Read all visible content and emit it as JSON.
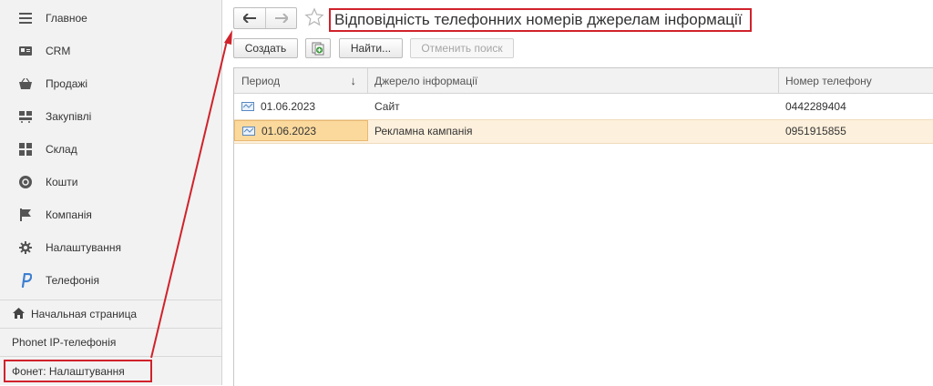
{
  "sidebar": {
    "items": [
      {
        "label": "Главное",
        "icon": "menu-icon"
      },
      {
        "label": "CRM",
        "icon": "crm-icon"
      },
      {
        "label": "Продажі",
        "icon": "basket-icon"
      },
      {
        "label": "Закупівлі",
        "icon": "purchases-icon"
      },
      {
        "label": "Склад",
        "icon": "warehouse-icon"
      },
      {
        "label": "Кошти",
        "icon": "money-icon"
      },
      {
        "label": "Компанія",
        "icon": "flag-icon"
      },
      {
        "label": "Налаштування",
        "icon": "gear-icon"
      },
      {
        "label": "Телефонія",
        "icon": "phonet-logo-icon"
      }
    ],
    "bottom": {
      "home": "Начальная страница",
      "phonet": "Phonet IP-телефонія",
      "settings": "Фонет: Налаштування"
    }
  },
  "header": {
    "title": "Відповідність телефонних номерів джерелам інформації"
  },
  "toolbar": {
    "create_label": "Создать",
    "find_label": "Найти...",
    "cancel_search_label": "Отменить поиск"
  },
  "table": {
    "columns": [
      "Период",
      "Джерело інформації",
      "Номер телефону"
    ],
    "sort_indicator": "↓",
    "rows": [
      {
        "period": "01.06.2023",
        "source": "Сайт",
        "phone": "0442289404"
      },
      {
        "period": "01.06.2023",
        "source": "Рекламна кампанія",
        "phone": "0951915855"
      }
    ]
  },
  "colors": {
    "highlight_red": "#d0222b",
    "selected_row": "#fdf0dc",
    "selected_cell": "#fbd99d",
    "sidebar_bg": "#f2f2f2"
  }
}
